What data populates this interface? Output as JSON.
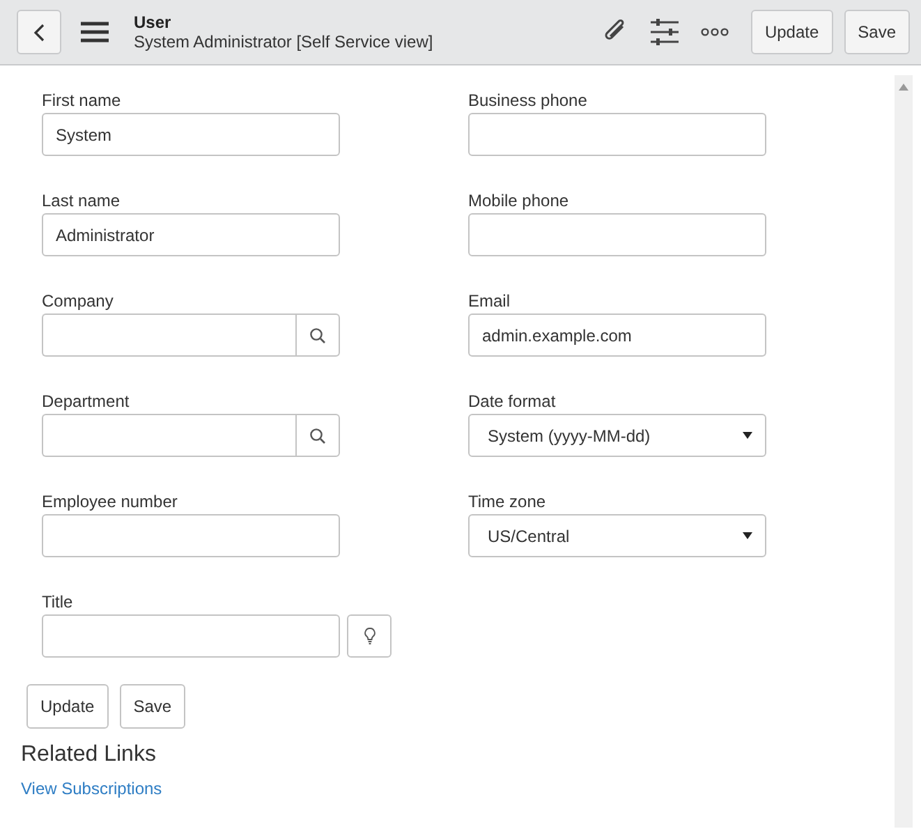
{
  "header": {
    "title": "User",
    "subtitle": "System Administrator [Self Service view]",
    "buttons": [
      "Update",
      "Save"
    ]
  },
  "columns": [
    [
      {
        "label": "First name",
        "kind": "text",
        "value": "System"
      },
      {
        "label": "Last name",
        "kind": "text",
        "value": "Administrator"
      },
      {
        "label": "Company",
        "kind": "reference"
      },
      {
        "label": "Department",
        "kind": "reference"
      },
      {
        "label": "Employee number",
        "kind": "text"
      },
      {
        "label": "Title",
        "kind": "suggestion"
      }
    ],
    [
      {
        "label": "Business phone",
        "kind": "text"
      },
      {
        "label": "Mobile phone",
        "kind": "text"
      },
      {
        "label": "Email",
        "kind": "text",
        "value": "admin.example.com"
      },
      {
        "label": "Date format",
        "kind": "select",
        "value": "System (yyyy-MM-dd)"
      },
      {
        "label": "Time zone",
        "kind": "select",
        "value": "US/Central"
      }
    ]
  ],
  "form_buttons": [
    "Update",
    "Save"
  ],
  "related_links": {
    "title": "Related Links",
    "links": [
      "View Subscriptions"
    ]
  }
}
